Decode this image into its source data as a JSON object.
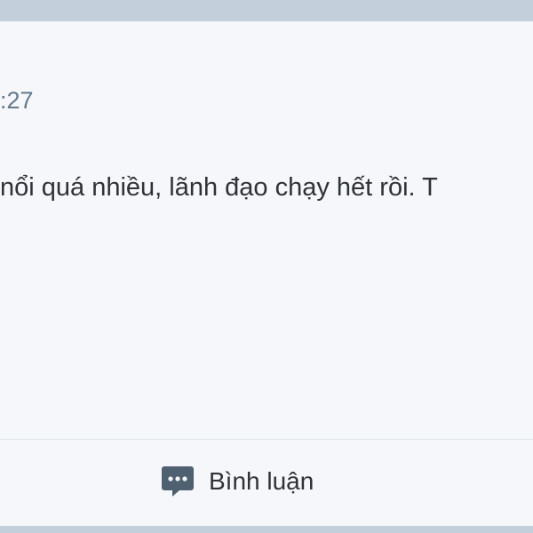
{
  "post": {
    "timestamp": ":27",
    "text": "nổi quá nhiều, lãnh đạo chạy hết rồi. T"
  },
  "actions": {
    "comment_label": "Bình luận",
    "comment_icon": "comment-bubble-icon"
  },
  "colors": {
    "frame": "#c3d0dc",
    "background": "#f5f7fa",
    "text": "#2f3236",
    "muted_text": "#66798b",
    "icon": "#4f6070"
  }
}
